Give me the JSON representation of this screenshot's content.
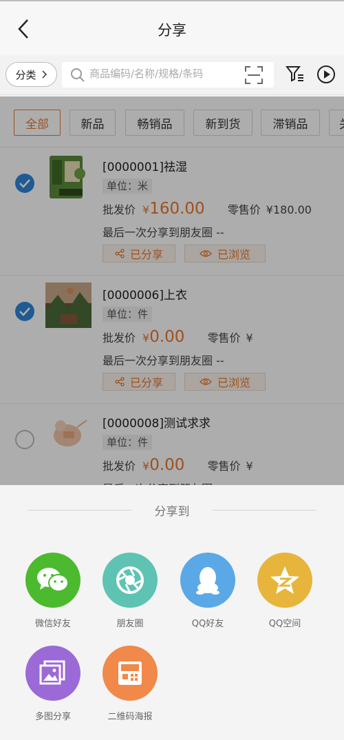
{
  "header": {
    "title": "分享"
  },
  "search": {
    "category_label": "分类",
    "placeholder": "商品编码/名称/规格/条码"
  },
  "tabs": [
    "全部",
    "新品",
    "畅销品",
    "新到货",
    "滞销品",
    "关"
  ],
  "labels": {
    "wholesale": "批发价",
    "retail": "零售价",
    "shared": "已分享",
    "viewed": "已浏览",
    "unit_prefix": "单位：",
    "yen": "¥"
  },
  "products": [
    {
      "name": "[0000001]祛湿",
      "unit": "单位：米",
      "wholesale_price": "160.00",
      "retail_price": "¥180.00",
      "last_share": "最后一次分享到朋友圈 --",
      "checked": true
    },
    {
      "name": "[0000006]上衣",
      "unit": "单位：件",
      "wholesale_price": "0.00",
      "retail_price": "¥",
      "last_share": "最后一次分享到朋友圈 --",
      "checked": true
    },
    {
      "name": "[0000008]测试求求",
      "unit": "单位：件",
      "wholesale_price": "0.00",
      "retail_price": "¥",
      "last_share": "最后一次分享到朋友圈 --",
      "checked": false
    }
  ],
  "share_sheet": {
    "title": "分享到",
    "options": [
      {
        "label": "微信好友",
        "icon": "wechat-icon",
        "color": "#4cba2e"
      },
      {
        "label": "朋友圈",
        "icon": "moments-icon",
        "color": "#5ec3b3"
      },
      {
        "label": "QQ好友",
        "icon": "qq-icon",
        "color": "#5aa8e6"
      },
      {
        "label": "QQ空间",
        "icon": "qzone-icon",
        "color": "#e7b53b"
      },
      {
        "label": "多图分享",
        "icon": "multi-image-icon",
        "color": "#9b6ad6"
      },
      {
        "label": "二维码海报",
        "icon": "qrcode-poster-icon",
        "color": "#f0894a"
      }
    ]
  },
  "colors": {
    "accent": "#e8772e",
    "check_blue": "#2f86d8"
  }
}
